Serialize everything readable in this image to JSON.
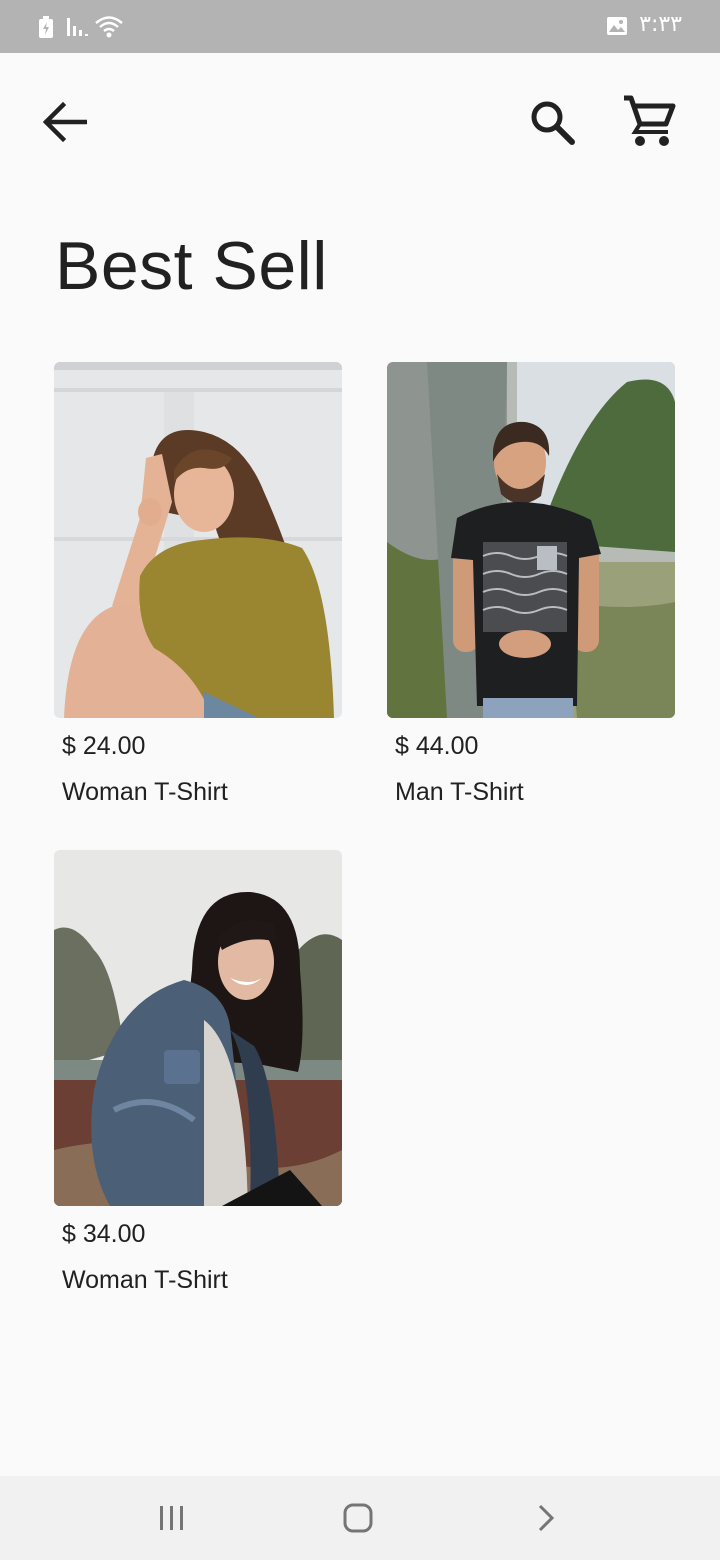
{
  "status_bar": {
    "time": "۳:۳۳",
    "icons": [
      "charging-battery-icon",
      "signal-icon",
      "wifi-icon",
      "gallery-notification-icon"
    ]
  },
  "app_bar": {
    "icons": [
      "arrow-back-icon",
      "search-icon",
      "shopping-cart-icon"
    ]
  },
  "page": {
    "title": "Best Sell"
  },
  "products": [
    {
      "price": "$ 24.00",
      "name": "Woman T-Shirt",
      "image": "woman-olive-tshirt-photo"
    },
    {
      "price": "$ 44.00",
      "name": "Man T-Shirt",
      "image": "man-black-tshirt-photo"
    },
    {
      "price": "$ 34.00",
      "name": "Woman T-Shirt",
      "image": "woman-denim-jacket-photo"
    }
  ],
  "nav_bar": {
    "icons": [
      "recent-apps-icon",
      "home-icon",
      "back-nav-icon"
    ]
  },
  "colors": {
    "status_bar_bg": "#b3b3b3",
    "background": "#fafafa",
    "text": "#212121",
    "nav_bar_bg": "#f1f1f1"
  }
}
